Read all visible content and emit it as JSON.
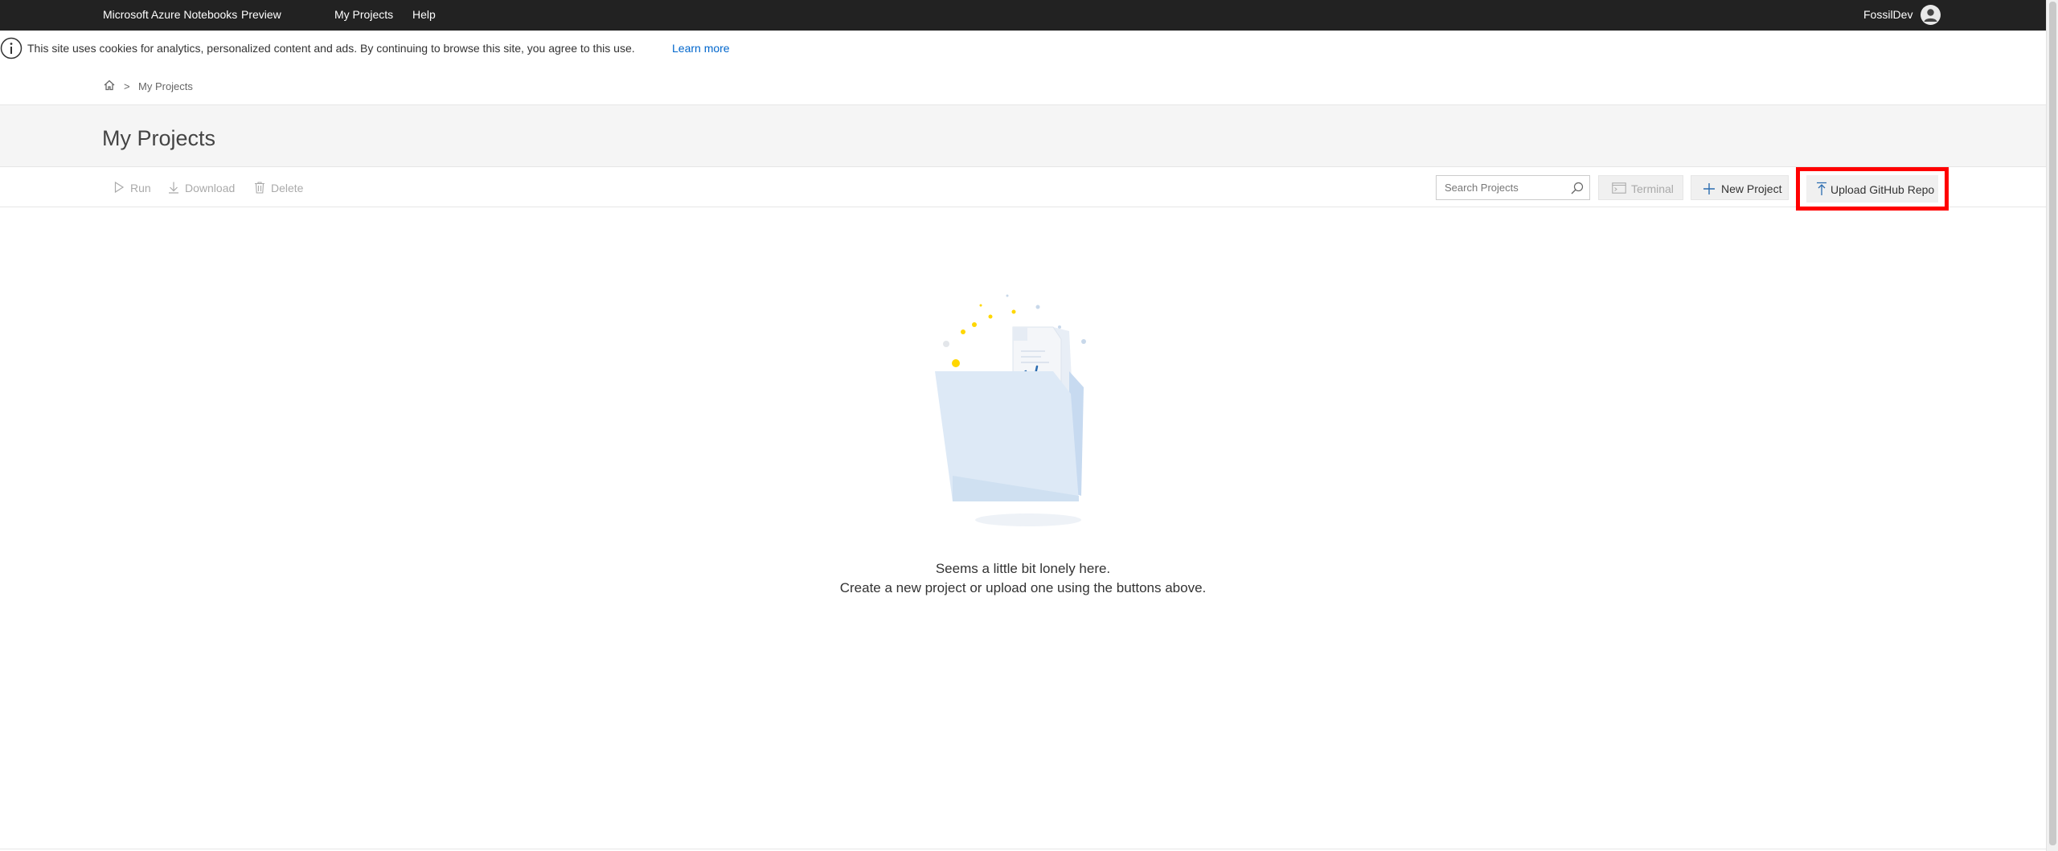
{
  "topbar": {
    "brand": "Microsoft Azure Notebooks",
    "preview": "Preview",
    "nav": {
      "projects": "My Projects",
      "help": "Help"
    },
    "user": "FossilDev"
  },
  "cookie": {
    "text": "This site uses cookies for analytics, personalized content and ads. By continuing to browse this site, you agree to this use.",
    "learn_more": "Learn more"
  },
  "breadcrumb": {
    "separator": ">",
    "current": "My Projects"
  },
  "page": {
    "title": "My Projects"
  },
  "toolbar": {
    "run": "Run",
    "download": "Download",
    "delete": "Delete",
    "search_placeholder": "Search Projects",
    "terminal": "Terminal",
    "new_project": "New Project",
    "upload_github": "Upload GitHub Repo"
  },
  "empty_state": {
    "line1": "Seems a little bit lonely here.",
    "line2": "Create a new project or upload one using the buttons above."
  },
  "colors": {
    "topbar_bg": "#222222",
    "link": "#0066cc",
    "highlight_border": "#ff0000",
    "accent_yellow": "#ffd700",
    "accent_blue": "#2b6cb0"
  }
}
